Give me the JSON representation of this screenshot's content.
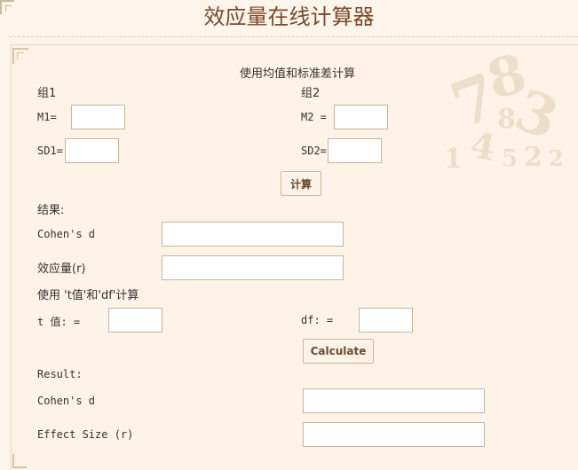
{
  "page": {
    "title": "效应量在线计算器"
  },
  "section1": {
    "heading": "使用均值和标准差计算",
    "group1_label": "组1",
    "group2_label": "组2",
    "m1_label": "M1=",
    "m2_label": "M2  =",
    "sd1_label": "SD1=",
    "sd2_label": "SD2=",
    "m1_value": "",
    "m2_value": "",
    "sd1_value": "",
    "sd2_value": "",
    "calc_button": "计算",
    "result_label": "结果:",
    "cohens_d_label": "Cohen's d",
    "effect_label": "效应量(r)",
    "cohens_d_value": "",
    "effect_value": ""
  },
  "section2": {
    "heading": "使用 't值'和'df'计算",
    "t_label": "t 值:    =",
    "df_label": "df:    =",
    "t_value": "",
    "df_value": "",
    "calc_button": "Calculate",
    "result_label": "Result:",
    "cohens_d_label": "Cohen's d",
    "effect_label": "Effect Size (r)",
    "cohens_d_value": "",
    "effect_value": ""
  },
  "decoration": {
    "digits": [
      "8",
      "3",
      "2",
      "5",
      "2",
      "7",
      "4",
      "1",
      "8"
    ]
  }
}
